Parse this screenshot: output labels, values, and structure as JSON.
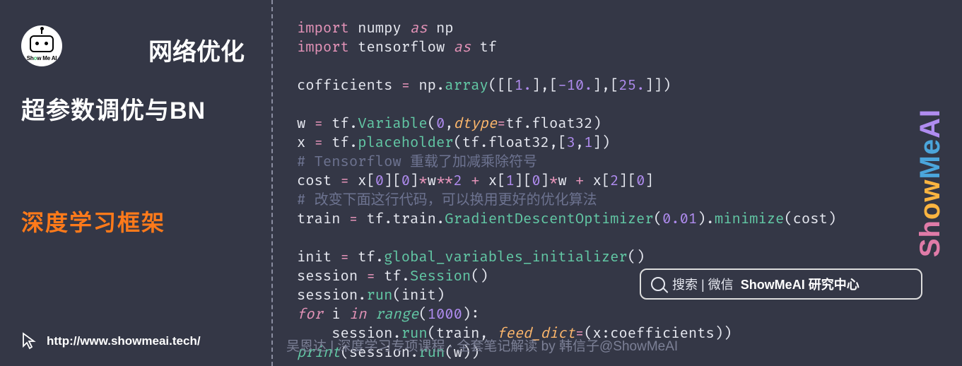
{
  "sidebar": {
    "logo_text_1": "Sh",
    "logo_text_2": "o",
    "logo_text_3": "w Me AI",
    "title1": "网络优化",
    "title2": "超参数调优与BN",
    "title3": "深度学习框架",
    "url": "http://www.showmeai.tech/"
  },
  "brand": {
    "p1": "Sh",
    "p2": "ow",
    "p3": "Me",
    "p4": "AI"
  },
  "search": {
    "prefix": "搜索 | 微信",
    "bold": "ShowMeAI 研究中心"
  },
  "bottom_note": "吴恩达 | 深度学习专项课程 · 全套笔记解读 by 韩信子@ShowMeAI",
  "code": {
    "l1_import": "import",
    "l1_mod": " numpy ",
    "l1_as": "as",
    "l1_alias": " np",
    "l2_import": "import",
    "l2_mod": " tensorflow ",
    "l2_as": "as",
    "l2_alias": " tf",
    "l4_a": "cofficients ",
    "l4_eq": "=",
    "l4_b": " np",
    "l4_dot": ".",
    "l4_fn": "array",
    "l4_c": "([[",
    "l4_n1": "1.",
    "l4_d": "],[",
    "l4_n2": "-10.",
    "l4_e": "],[",
    "l4_n3": "25.",
    "l4_f": "]])",
    "l6_a": "w ",
    "l6_eq": "=",
    "l6_b": " tf",
    "l6_dot": ".",
    "l6_fn": "Variable",
    "l6_c": "(",
    "l6_n0": "0",
    "l6_cm": ",",
    "l6_kw": "dtype",
    "l6_eq2": "=",
    "l6_d": "tf",
    "l6_dot2": ".",
    "l6_e": "float32)",
    "l7_a": "x ",
    "l7_eq": "=",
    "l7_b": " tf",
    "l7_dot": ".",
    "l7_fn": "placeholder",
    "l7_c": "(tf",
    "l7_dot2": ".",
    "l7_d": "float32,[",
    "l7_n1": "3",
    "l7_cm": ",",
    "l7_n2": "1",
    "l7_e": "])",
    "l8": "# Tensorflow 重载了加减乘除符号",
    "l9_a": "cost ",
    "l9_eq": "=",
    "l9_b": " x[",
    "l9_n0a": "0",
    "l9_c": "][",
    "l9_n0b": "0",
    "l9_d": "]",
    "l9_op1": "*",
    "l9_e": "w",
    "l9_op2": "**",
    "l9_n2": "2",
    "l9_sp1": " ",
    "l9_pl1": "+",
    "l9_f": " x[",
    "l9_n1a": "1",
    "l9_g": "][",
    "l9_n1b": "0",
    "l9_h": "]",
    "l9_op3": "*",
    "l9_i": "w ",
    "l9_pl2": "+",
    "l9_j": " x[",
    "l9_n2a": "2",
    "l9_k": "][",
    "l9_n2b": "0",
    "l9_l": "]",
    "l10": "# 改变下面这行代码，可以换用更好的优化算法",
    "l11_a": "train ",
    "l11_eq": "=",
    "l11_b": " tf",
    "l11_dot": ".",
    "l11_c": "train",
    "l11_dot2": ".",
    "l11_fn": "GradientDescentOptimizer",
    "l11_d": "(",
    "l11_n": "0.01",
    "l11_e": ")",
    "l11_dot3": ".",
    "l11_fn2": "minimize",
    "l11_f": "(cost)",
    "l13_a": "init ",
    "l13_eq": "=",
    "l13_b": " tf",
    "l13_dot": ".",
    "l13_fn": "global_variables_initializer",
    "l13_c": "()",
    "l14_a": "session ",
    "l14_eq": "=",
    "l14_b": " tf",
    "l14_dot": ".",
    "l14_fn": "Session",
    "l14_c": "()",
    "l15_a": "session",
    "l15_dot": ".",
    "l15_fn": "run",
    "l15_b": "(init)",
    "l16_for": "for",
    "l16_a": " i ",
    "l16_in": "in",
    "l16_sp": " ",
    "l16_fn": "range",
    "l16_b": "(",
    "l16_n": "1000",
    "l16_c": "):",
    "l17_ind": "    ",
    "l17_a": "session",
    "l17_dot": ".",
    "l17_fn": "run",
    "l17_b": "(train, ",
    "l17_kw": "feed_dict",
    "l17_eq": "=",
    "l17_c": "(x:coefficients))",
    "l18_fn": "print",
    "l18_a": "(session",
    "l18_dot": ".",
    "l18_fn2": "run",
    "l18_b": "(w))"
  }
}
